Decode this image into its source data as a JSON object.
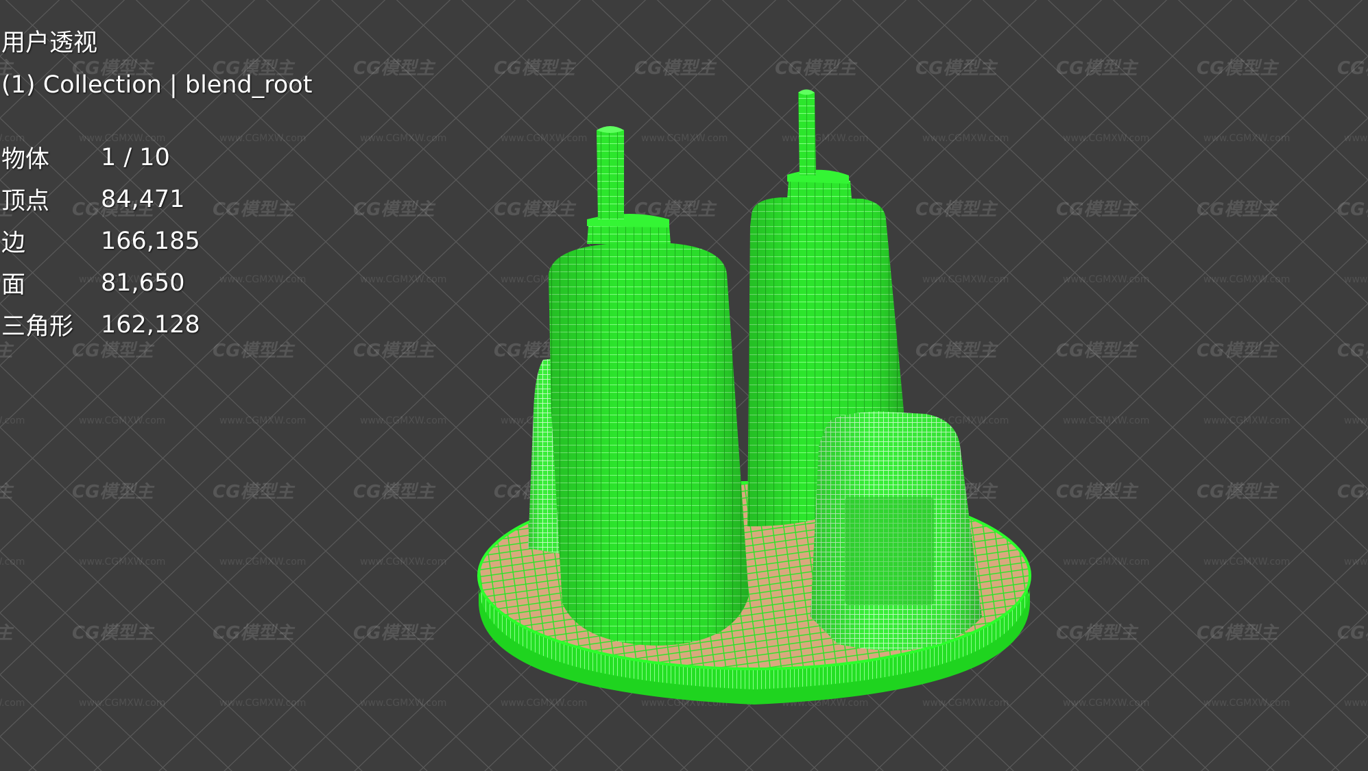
{
  "viewport": {
    "view_name": "用户透视",
    "collection_line": "(1) Collection | blend_root",
    "background_color": "#3d3d3d",
    "grid_color": "#5a5a5a",
    "wireframe_color": "#22ff22",
    "base_fill_color": "#e8a27a"
  },
  "stats": [
    {
      "label": "物体",
      "value": "1 / 10"
    },
    {
      "label": "顶点",
      "value": "84,471"
    },
    {
      "label": "边",
      "value": "166,185"
    },
    {
      "label": "面",
      "value": "81,650"
    },
    {
      "label": "三角形",
      "value": "162,128"
    }
  ],
  "watermark": {
    "logo_text": "CG模型主",
    "url_text": "www.CGMXW.com"
  }
}
